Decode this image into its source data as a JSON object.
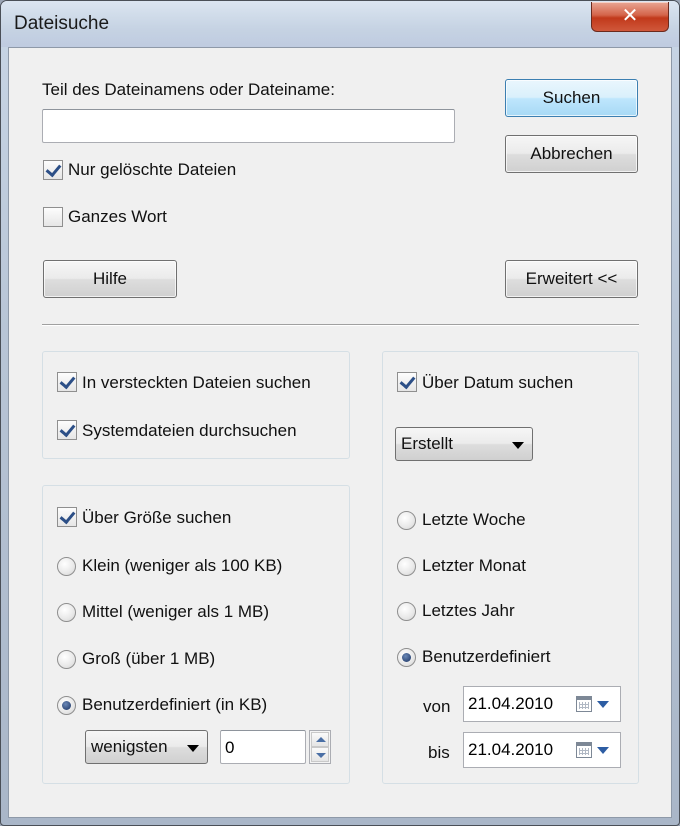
{
  "window": {
    "title": "Dateisuche",
    "close_glyph": "✕"
  },
  "search": {
    "label": "Teil des Dateinamens oder Dateiname:",
    "value": "",
    "only_deleted": {
      "label": "Nur gelöschte Dateien",
      "checked": true
    },
    "whole_word": {
      "label": "Ganzes Wort",
      "checked": false
    }
  },
  "buttons": {
    "search": "Suchen",
    "cancel": "Abbrechen",
    "help": "Hilfe",
    "advanced": "Erweitert <<"
  },
  "hidden_system": {
    "hidden_files": {
      "label": "In versteckten Dateien suchen",
      "checked": true
    },
    "system_files": {
      "label": "Systemdateien durchsuchen",
      "checked": true
    }
  },
  "size": {
    "by_size": {
      "label": "Über Größe suchen",
      "checked": true
    },
    "options": [
      {
        "label": "Klein (weniger als 100 KB)",
        "selected": false
      },
      {
        "label": "Mittel (weniger als 1 MB)",
        "selected": false
      },
      {
        "label": "Groß (über 1 MB)",
        "selected": false
      },
      {
        "label": "Benutzerdefiniert (in KB)",
        "selected": true
      }
    ],
    "mode_select": "wenigsten",
    "amount": "0"
  },
  "date": {
    "by_date": {
      "label": "Über Datum suchen",
      "checked": true
    },
    "type_select": "Erstellt",
    "options": [
      {
        "label": "Letzte Woche",
        "selected": false
      },
      {
        "label": "Letzter Monat",
        "selected": false
      },
      {
        "label": "Letztes Jahr",
        "selected": false
      },
      {
        "label": "Benutzerdefiniert",
        "selected": true
      }
    ],
    "from_label": "von",
    "from_value": "21.04.2010",
    "to_label": "bis",
    "to_value": "21.04.2010"
  }
}
